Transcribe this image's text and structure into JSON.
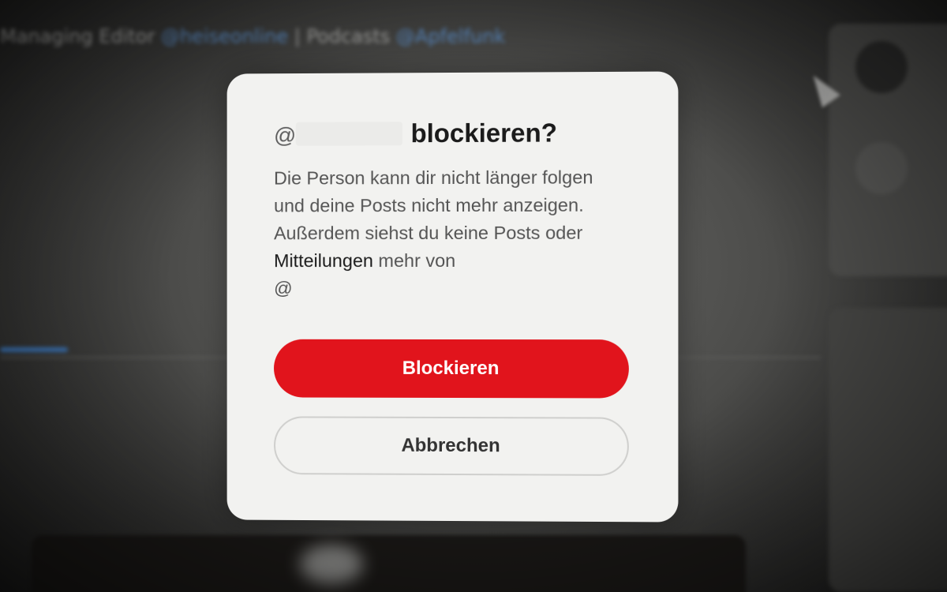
{
  "background": {
    "lines": [
      {
        "text": "Managing Editor",
        "cls": "",
        "x": 0,
        "y": 0
      },
      {
        "text": "@heiseonline",
        "cls": "link",
        "x": 0,
        "y": 0
      },
      {
        "text": "| Podcasts",
        "cls": "",
        "x": 0,
        "y": 0
      },
      {
        "text": "@Apfelfunk",
        "cls": "link",
        "x": 0,
        "y": 0
      }
    ]
  },
  "dialog": {
    "at_symbol": "@",
    "title_action": "blockieren?",
    "body_part1": "Die Person kann dir nicht länger folgen und deine Posts nicht mehr anzeigen. Außerdem siehst du keine Posts oder ",
    "body_highlight": "Mitteilungen",
    "body_part2": " mehr von",
    "body_at": "@",
    "block_button": "Blockieren",
    "cancel_button": "Abbrechen"
  },
  "colors": {
    "block_button": "#e1141c",
    "dialog_bg": "#f2f2f0"
  }
}
